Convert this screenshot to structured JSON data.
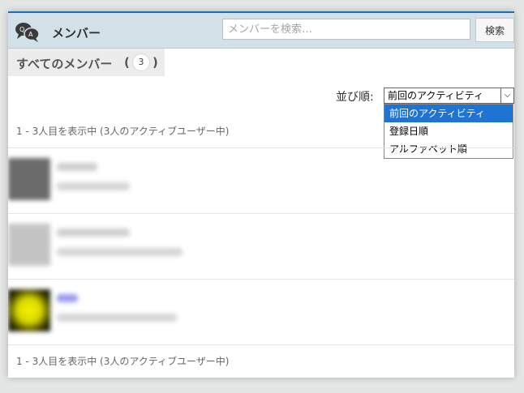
{
  "header": {
    "title": "メンバー",
    "logo_icon": "chat-bubbles-icon",
    "search_placeholder": "メンバーを検索…",
    "search_button": "検索"
  },
  "tabs": {
    "all_label": "すべてのメンバー",
    "paren_open": "(",
    "paren_close": ")",
    "all_count": "3"
  },
  "sort": {
    "label": "並び順:",
    "selected": "前回のアクティビティ",
    "options": [
      "前回のアクティビティ",
      "登録日順",
      "アルファベット順"
    ]
  },
  "summary_top": "1 - 3人目を表示中 (3人のアクティブユーザー中)",
  "summary_bottom": "1 - 3人目を表示中 (3人のアクティブユーザー中)",
  "colors": {
    "accent": "#1f6fae",
    "header_bg": "#d2e0e8",
    "selected_option": "#1e73d3"
  },
  "members": [
    {
      "avatar_color": "#6b6b6b"
    },
    {
      "avatar_color": "#bfbfbf"
    },
    {
      "avatar_color": "#e6e600",
      "name_color": "#6a6ae8"
    }
  ]
}
